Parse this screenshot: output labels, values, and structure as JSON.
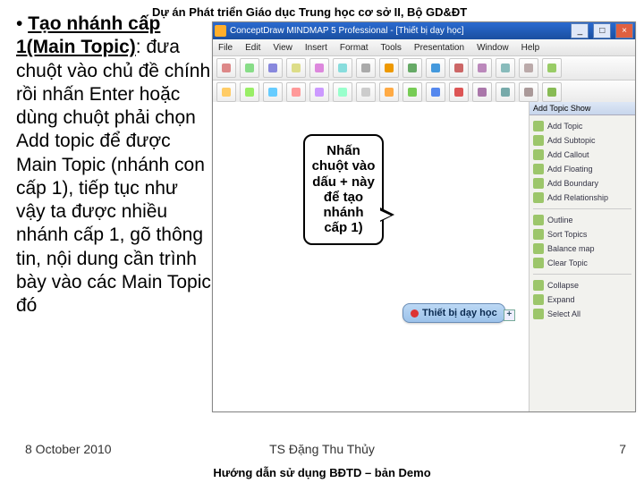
{
  "header": "Dự án Phát triển Giáo dục Trung học cơ sở II, Bộ GD&ĐT",
  "bullet": {
    "lead_title": "Tạo nhánh cấp 1(Main Topic)",
    "rest": ": đưa chuột vào chủ đề chính rồi nhấn Enter hoặc dùng chuột phải chọn Add topic để được Main Topic (nhánh con cấp 1), tiếp tục như vậy ta được nhiều nhánh cấp 1, gõ thông tin, nội dung cần trình bày vào các Main Topic đó"
  },
  "callout_text": "Nhấn chuột vào dấu + này để tạo nhánh cấp 1)",
  "footer": {
    "date": "8 October 2010",
    "author": "TS Đặng Thu Thủy",
    "sub": "Hướng dẫn sử dụng BĐTD – bản Demo",
    "page": "7"
  },
  "app": {
    "title": "ConceptDraw MINDMAP 5 Professional - [Thiết bị dạy học]",
    "menu": [
      "File",
      "Edit",
      "View",
      "Insert",
      "Format",
      "Tools",
      "Presentation",
      "Window",
      "Help"
    ],
    "central_topic": "Thiết bị dạy học",
    "plus": "+",
    "right_pane": {
      "title": "Add Topic  Show",
      "items": [
        "Add Topic",
        "Add Subtopic",
        "Add Callout",
        "Add Floating",
        "Add Boundary",
        "Add Relationship",
        "Outline",
        "Sort Topics",
        "Balance map",
        "Clear Topic",
        "Collapse",
        "Expand",
        "Select All"
      ]
    },
    "toolbar_colors1": [
      "#d88",
      "#8d8",
      "#88d",
      "#dd8",
      "#d8d",
      "#8dd",
      "#aaa",
      "#e90",
      "#6a6",
      "#49d",
      "#c66",
      "#b8b",
      "#8bb",
      "#baa",
      "#9c6"
    ],
    "toolbar_colors2": [
      "#fc6",
      "#9e6",
      "#6cf",
      "#f99",
      "#c9f",
      "#9fc",
      "#ccc",
      "#fa4",
      "#7c5",
      "#58e",
      "#d55",
      "#a7a",
      "#7aa",
      "#a99",
      "#8b5"
    ]
  }
}
